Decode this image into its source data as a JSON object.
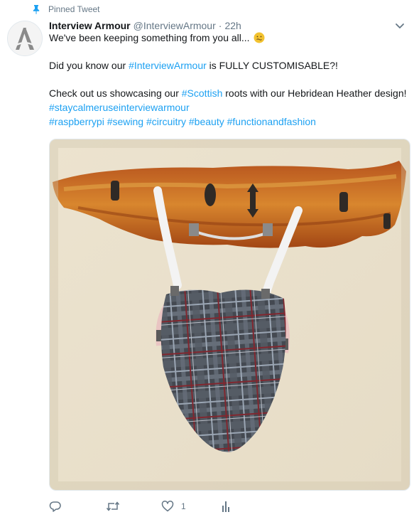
{
  "pinned": {
    "label": "Pinned Tweet",
    "icon": "pin-icon",
    "color": "#1da1f2"
  },
  "author": {
    "display_name": "Interview Armour",
    "handle": "@InterviewArmour",
    "separator": "·",
    "time": "22h"
  },
  "tweet": {
    "line1": "We've been keeping something from you all...",
    "emoji": "nauseated-face-emoji",
    "line2_before": "Did you know our ",
    "line2_tag": "#InterviewArmour",
    "line2_after": " is FULLY CUSTOMISABLE?!",
    "line3_before": "Check out us showcasing our ",
    "line3_tag": "#Scottish",
    "line3_after": " roots with our Hebridean Heather design!",
    "tags_line1": [
      "#staycalmeruseinterviewarmour"
    ],
    "tags_line2": [
      "#raspberrypi",
      "#sewing",
      "#circuitry",
      "#beauty",
      "#functionandfashion"
    ]
  },
  "actions": {
    "reply_count": "",
    "retweet_count": "",
    "like_count": "1",
    "icons": [
      "reply-icon",
      "retweet-icon",
      "like-icon",
      "analytics-icon"
    ]
  },
  "colors": {
    "link": "#1da1f2",
    "muted": "#657786",
    "text": "#14171a"
  }
}
